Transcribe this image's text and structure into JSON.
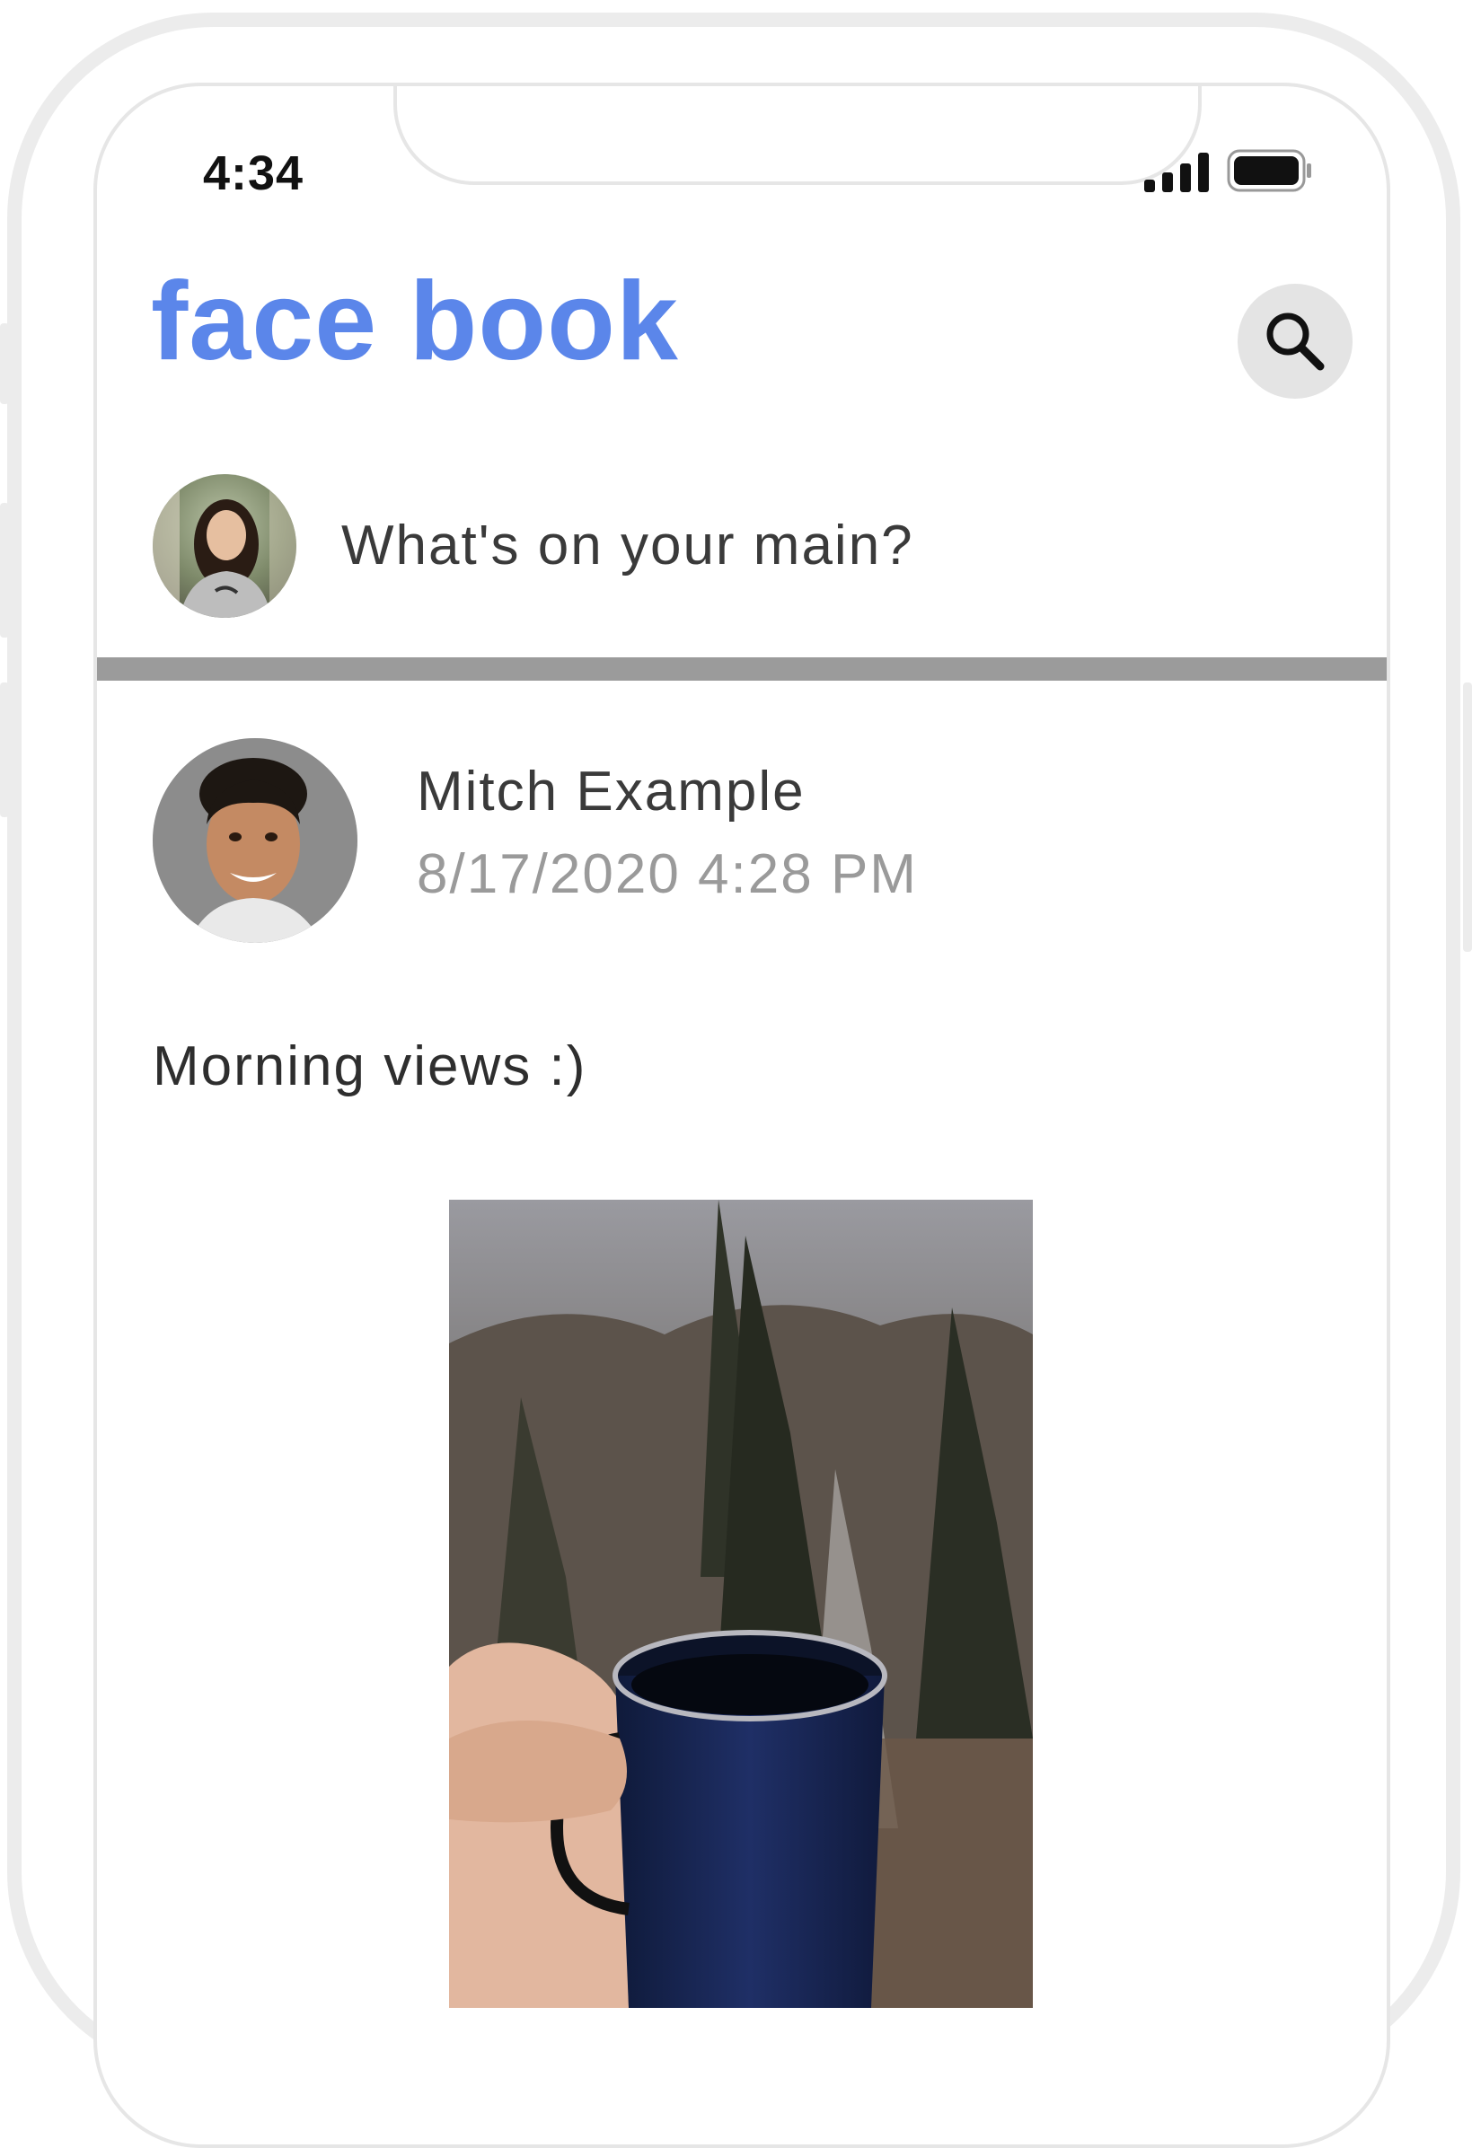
{
  "status_bar": {
    "time": "4:34",
    "signal_icon": "cellular-signal-icon",
    "battery_icon": "battery-icon"
  },
  "header": {
    "app_title": "face book",
    "search_icon": "search-icon"
  },
  "composer": {
    "placeholder": "What's on your main?"
  },
  "post": {
    "author": "Mitch Example",
    "timestamp": "8/17/2020 4:28 PM",
    "text": "Morning views :)"
  },
  "colors": {
    "brand": "#5b86ea",
    "divider": "#9b9b9b",
    "search_bg": "#e4e4e4"
  }
}
